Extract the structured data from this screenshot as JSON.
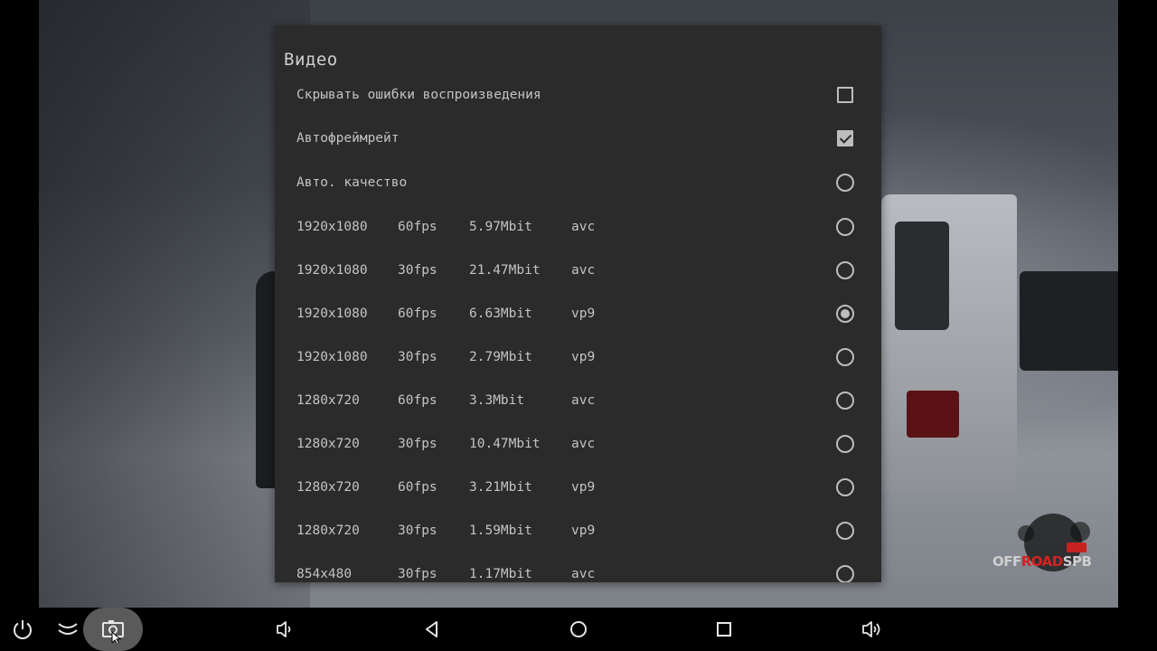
{
  "dialog": {
    "title": "Видео",
    "options": [
      {
        "label": "Скрывать ошибки воспроизведения",
        "control": "checkbox",
        "checked": false
      },
      {
        "label": "Автофреймрейт",
        "control": "checkbox",
        "checked": true
      },
      {
        "label": "Авто. качество",
        "control": "radio",
        "checked": false
      }
    ],
    "qualities": [
      {
        "resolution": "1920x1080",
        "fps": "60fps",
        "bitrate": "5.97Mbit",
        "codec": "avc",
        "selected": false
      },
      {
        "resolution": "1920x1080",
        "fps": "30fps",
        "bitrate": "21.47Mbit",
        "codec": "avc",
        "selected": false
      },
      {
        "resolution": "1920x1080",
        "fps": "60fps",
        "bitrate": "6.63Mbit",
        "codec": "vp9",
        "selected": true
      },
      {
        "resolution": "1920x1080",
        "fps": "30fps",
        "bitrate": "2.79Mbit",
        "codec": "vp9",
        "selected": false
      },
      {
        "resolution": "1280x720",
        "fps": "60fps",
        "bitrate": "3.3Mbit",
        "codec": "avc",
        "selected": false
      },
      {
        "resolution": "1280x720",
        "fps": "30fps",
        "bitrate": "10.47Mbit",
        "codec": "avc",
        "selected": false
      },
      {
        "resolution": "1280x720",
        "fps": "60fps",
        "bitrate": "3.21Mbit",
        "codec": "vp9",
        "selected": false
      },
      {
        "resolution": "1280x720",
        "fps": "30fps",
        "bitrate": "1.59Mbit",
        "codec": "vp9",
        "selected": false
      },
      {
        "resolution": "854x480",
        "fps": "30fps",
        "bitrate": "1.17Mbit",
        "codec": "avc",
        "selected": false
      }
    ]
  },
  "video": {
    "watermark_part1": "OFF",
    "watermark_part2": "ROAD",
    "watermark_part3": "SPB",
    "watermark_badge": "YouTube"
  },
  "navbar": {
    "buttons": [
      {
        "name": "power-icon"
      },
      {
        "name": "collapse-icon"
      },
      {
        "name": "screenshot-icon",
        "active": true
      },
      {
        "name": "volume-down-icon"
      },
      {
        "name": "back-icon"
      },
      {
        "name": "home-icon"
      },
      {
        "name": "recents-icon"
      },
      {
        "name": "volume-up-icon"
      }
    ]
  },
  "colors": {
    "dialog_bg": "#2b2b2b",
    "text": "#c3c3c3",
    "control": "#bdbdbd",
    "navbar_bg": "#000000",
    "active_button_bg": "#5a5a5a"
  }
}
